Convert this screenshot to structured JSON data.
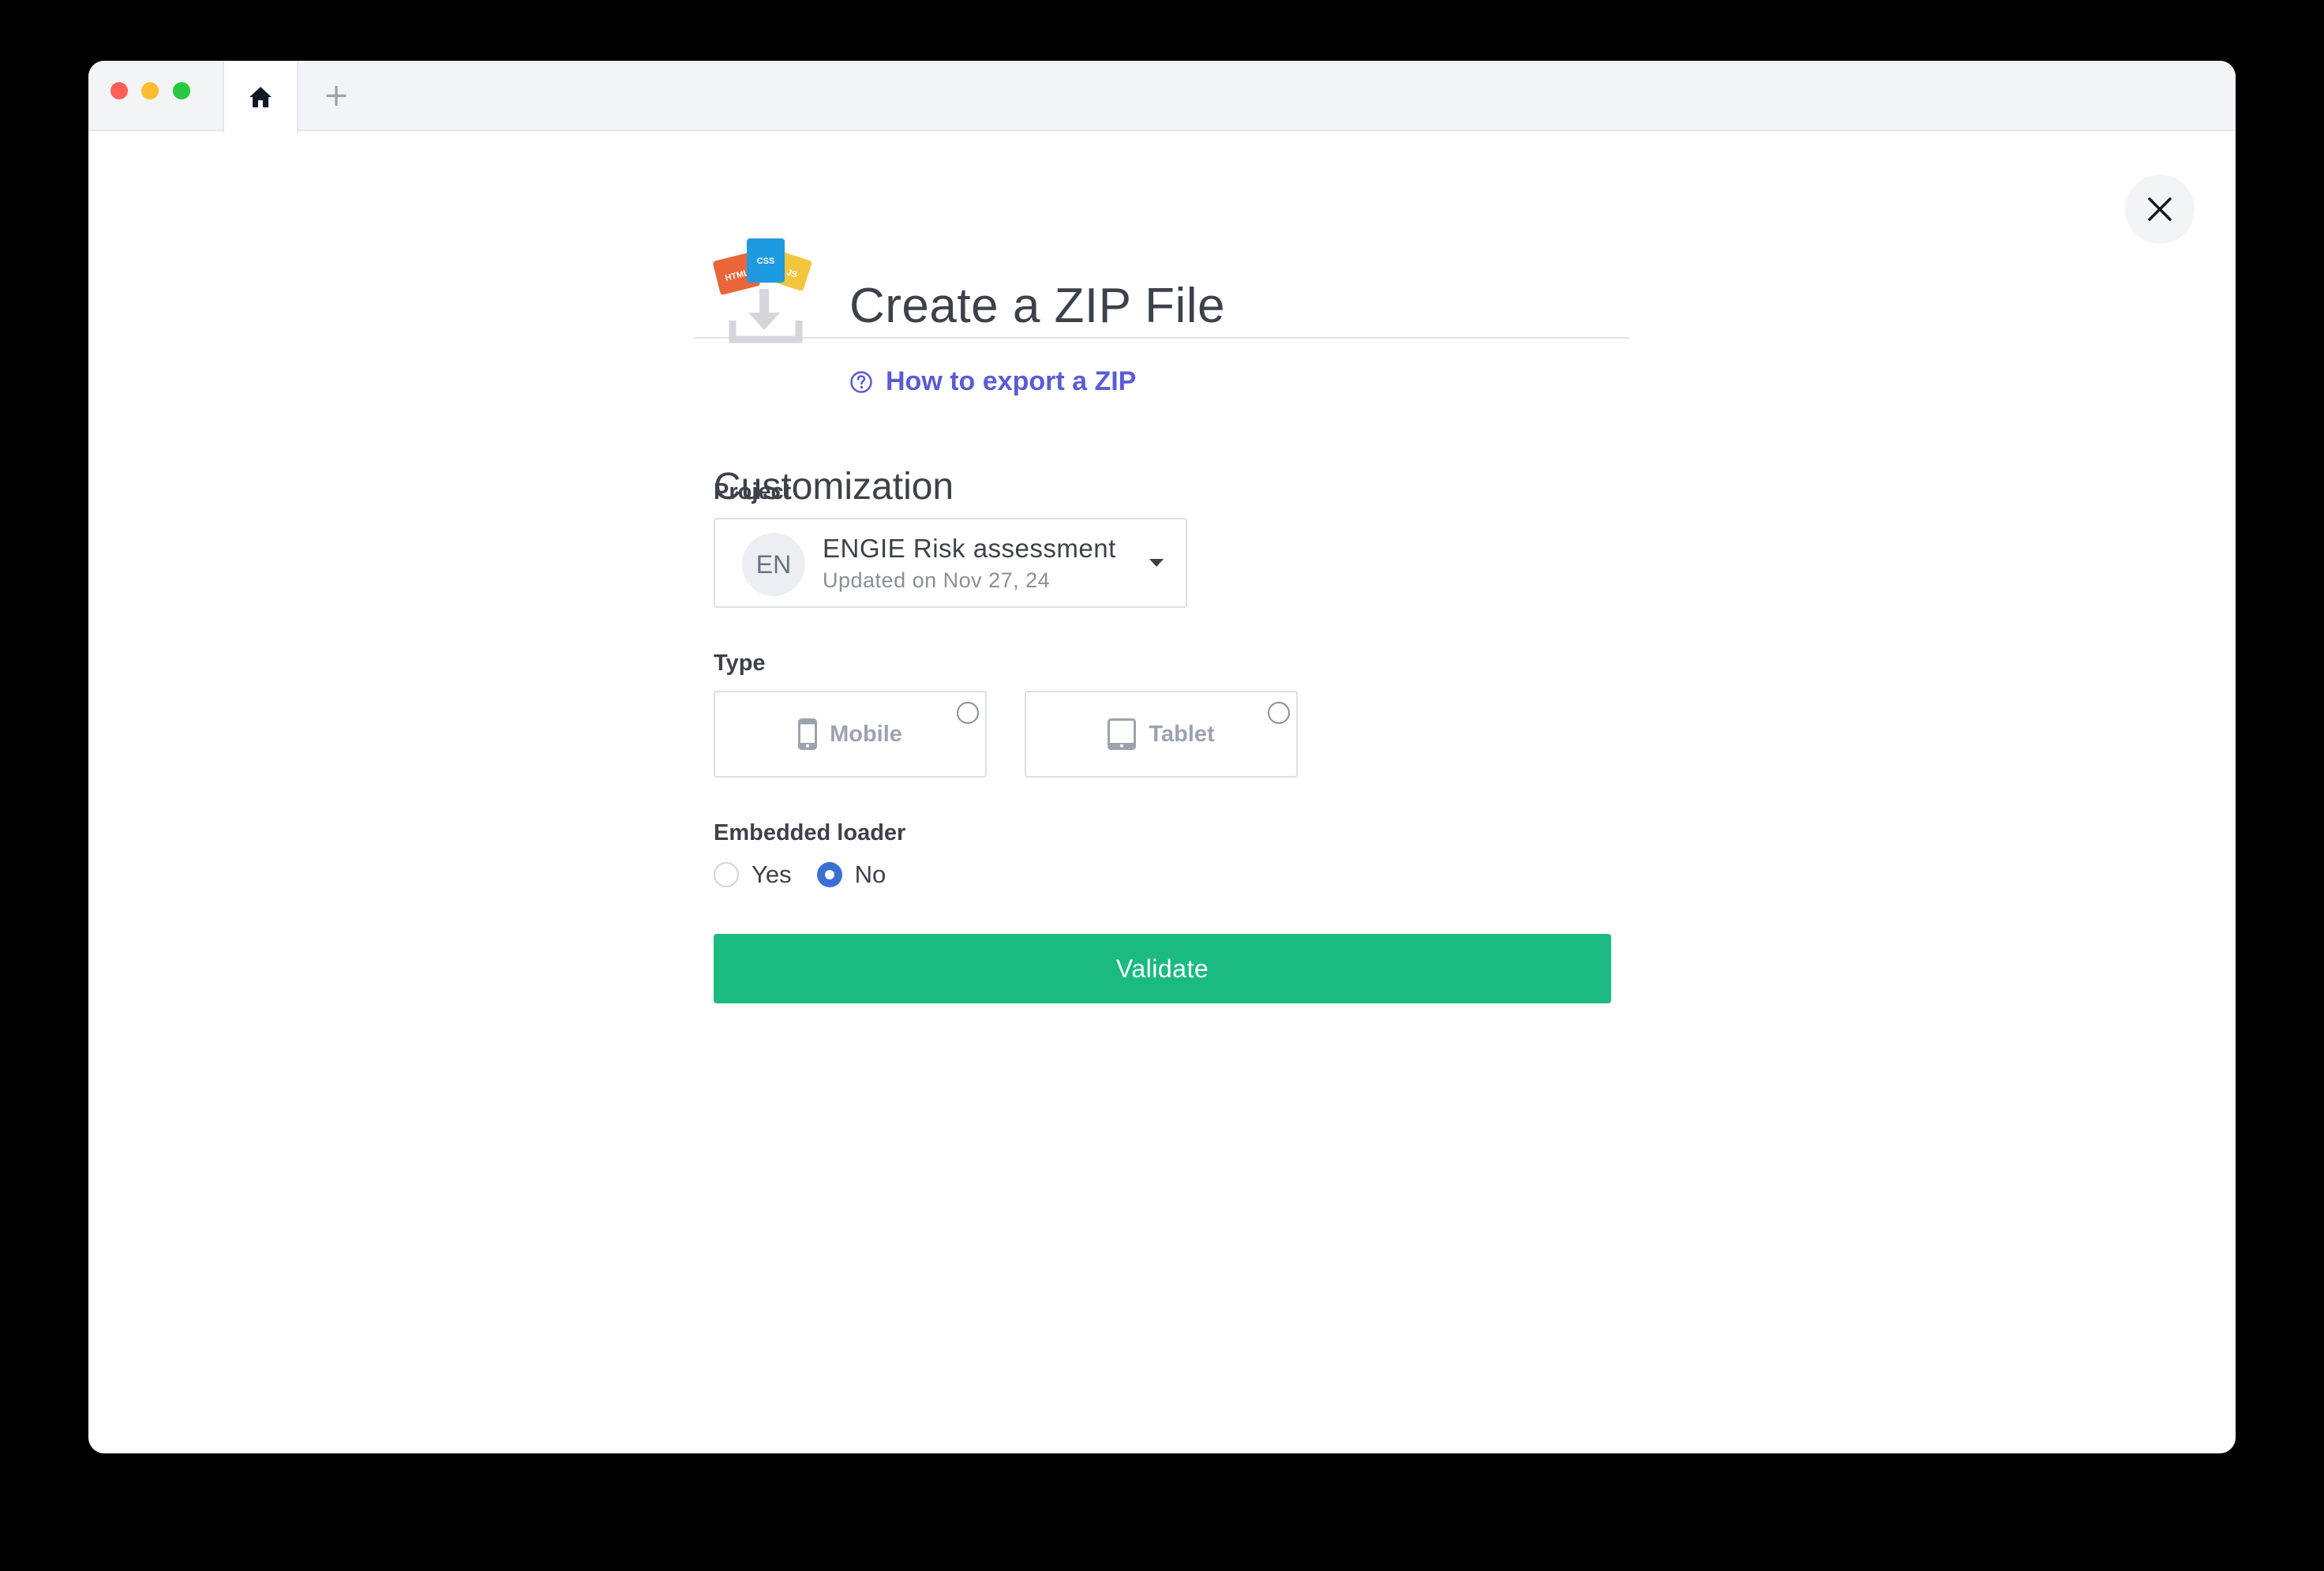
{
  "browser": {
    "tabs": [
      {
        "icon": "home-icon"
      },
      {
        "icon": "plus-icon",
        "label": "+"
      }
    ]
  },
  "dialog": {
    "title": "Create a ZIP File",
    "help_link": "How to export a ZIP",
    "logo_labels": {
      "html": "HTML",
      "css": "CSS",
      "js": "JS"
    },
    "close_icon": "close-icon"
  },
  "form": {
    "section_title": "Customization",
    "project": {
      "label": "Project",
      "avatar": "EN",
      "name": "ENGIE Risk assessment",
      "updated": "Updated on Nov 27, 24"
    },
    "type": {
      "label": "Type",
      "options": [
        {
          "label": "Mobile",
          "icon": "mobile-icon",
          "selected": false
        },
        {
          "label": "Tablet",
          "icon": "tablet-icon",
          "selected": false
        }
      ]
    },
    "embedded_loader": {
      "label": "Embedded loader",
      "options": [
        {
          "label": "Yes",
          "selected": false
        },
        {
          "label": "No",
          "selected": true
        }
      ]
    },
    "submit_label": "Validate"
  },
  "colors": {
    "accent": "#1aba80",
    "link": "#5b5bd6",
    "radio_selected": "#3b6fd4"
  }
}
